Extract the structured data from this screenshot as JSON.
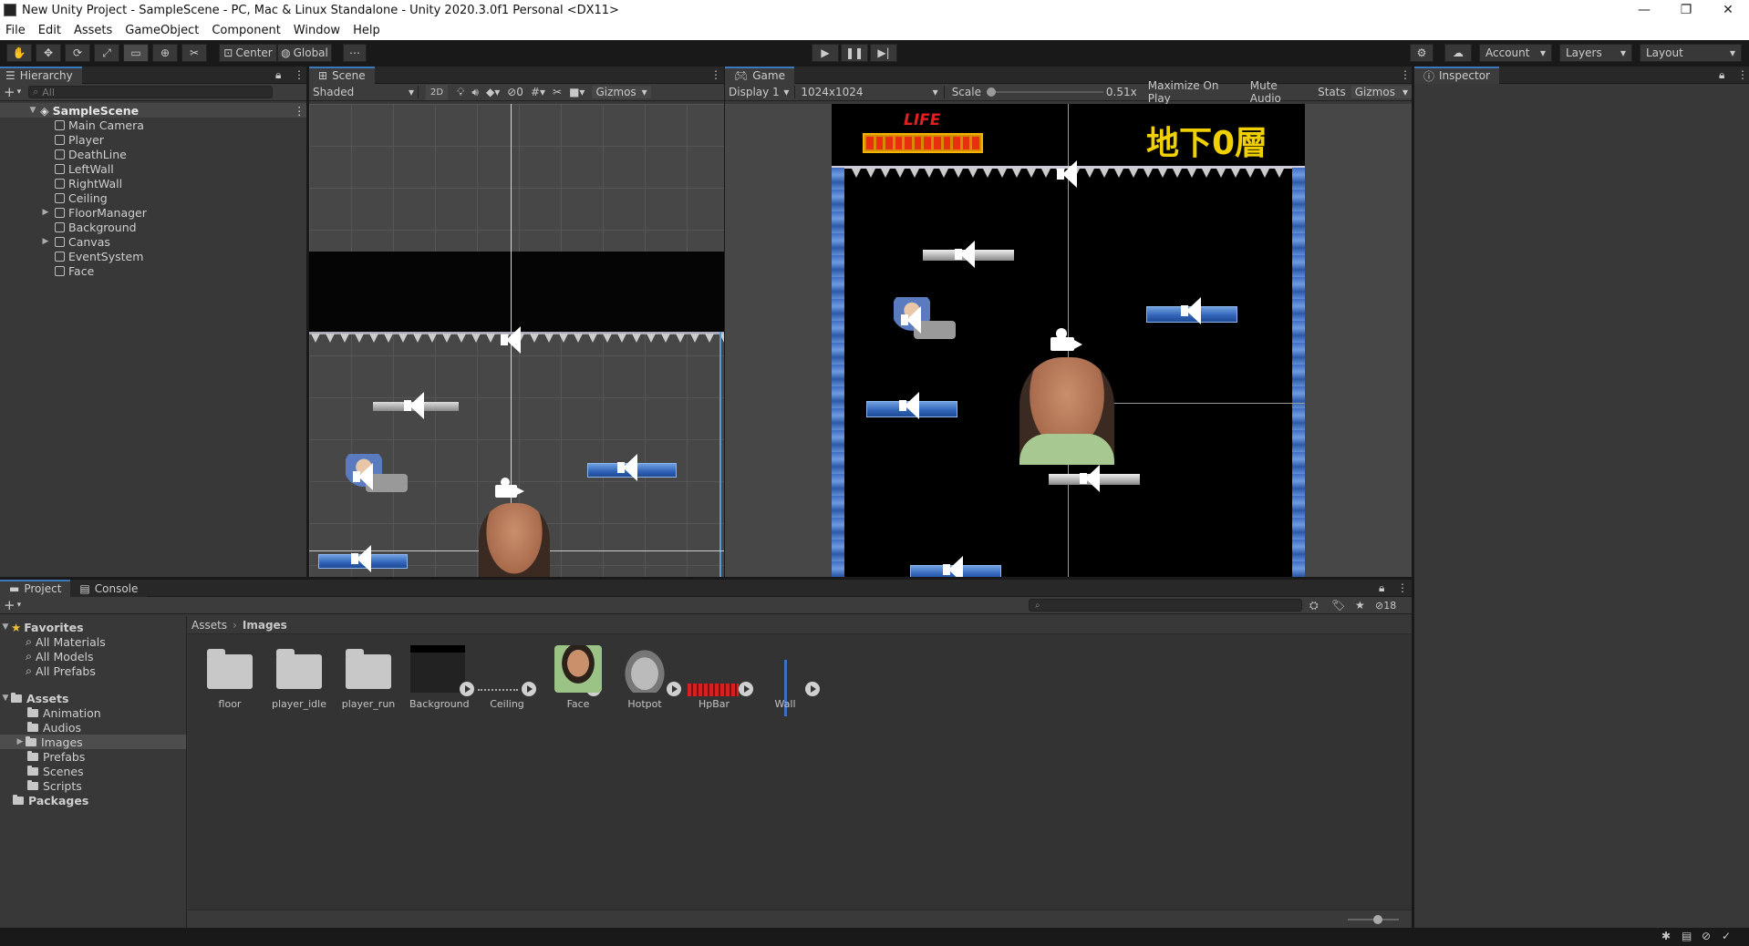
{
  "window": {
    "title": "New Unity Project - SampleScene - PC, Mac & Linux Standalone - Unity 2020.3.0f1 Personal <DX11>",
    "controls": [
      "—",
      "❐",
      "✕"
    ]
  },
  "menu": [
    "File",
    "Edit",
    "Assets",
    "GameObject",
    "Component",
    "Window",
    "Help"
  ],
  "toolbar": {
    "pivot": "Center",
    "space": "Global",
    "account": "Account",
    "layers": "Layers",
    "layout": "Layout"
  },
  "hierarchy": {
    "tab": "Hierarchy",
    "search_placeholder": "All",
    "scene": "SampleScene",
    "items": [
      {
        "name": "Main Camera",
        "expandable": false
      },
      {
        "name": "Player",
        "expandable": false
      },
      {
        "name": "DeathLine",
        "expandable": false
      },
      {
        "name": "LeftWall",
        "expandable": false
      },
      {
        "name": "RightWall",
        "expandable": false
      },
      {
        "name": "Ceiling",
        "expandable": false
      },
      {
        "name": "FloorManager",
        "expandable": true
      },
      {
        "name": "Background",
        "expandable": false
      },
      {
        "name": "Canvas",
        "expandable": true
      },
      {
        "name": "EventSystem",
        "expandable": false
      },
      {
        "name": "Face",
        "expandable": false
      }
    ]
  },
  "scene_view": {
    "tab": "Scene",
    "shading": "Shaded",
    "mode_2d": "2D",
    "hidden_count": "0",
    "gizmos": "Gizmos"
  },
  "game_view": {
    "tab": "Game",
    "display": "Display 1",
    "resolution": "1024x1024",
    "scale_label": "Scale",
    "scale_value": "0.51x",
    "maximize": "Maximize On Play",
    "mute": "Mute Audio",
    "stats": "Stats",
    "gizmos": "Gizmos",
    "hud_life": "LIFE",
    "hud_floor": "地下0層"
  },
  "inspector": {
    "tab": "Inspector"
  },
  "project": {
    "tab_project": "Project",
    "tab_console": "Console",
    "hidden_count": "18",
    "breadcrumb": [
      "Assets",
      "Images"
    ],
    "favorites": {
      "label": "Favorites",
      "items": [
        "All Materials",
        "All Models",
        "All Prefabs"
      ]
    },
    "assets": {
      "label": "Assets",
      "items": [
        "Animation",
        "Audios",
        "Images",
        "Prefabs",
        "Scenes",
        "Scripts"
      ],
      "selected": "Images"
    },
    "packages": "Packages",
    "files": [
      "floor",
      "player_idle",
      "player_run",
      "Background",
      "Ceiling",
      "Face",
      "Hotpot",
      "HpBar",
      "Wall"
    ]
  },
  "colors": {
    "accent_tab": "#3a79bb",
    "hud_life": "#e02020",
    "hud_floor": "#f0d000",
    "platform": "#3c6fc8"
  }
}
